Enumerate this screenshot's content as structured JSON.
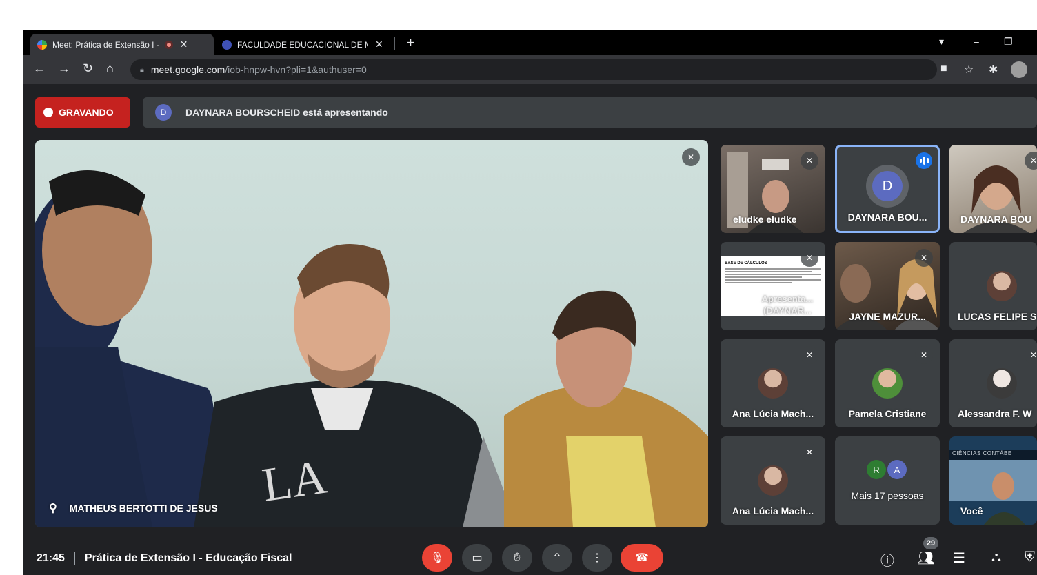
{
  "browser": {
    "tabs": [
      {
        "title": "Meet: Prática de Extensão I -",
        "active": true,
        "recording": true
      },
      {
        "title": "FACULDADE EDUCACIONAL DE M",
        "active": false
      }
    ],
    "url_domain": "meet.google.com",
    "url_path": "/iob-hnpw-hvn?pli=1&authuser=0"
  },
  "meet": {
    "recording_label": "GRAVANDO",
    "presenter_initial": "D",
    "presenting_text": "DAYNARA BOURSCHEID está apresentando",
    "main_speaker": "MATHEUS BERTOTTI DE JESUS",
    "tiles": [
      {
        "name": "eludke eludke"
      },
      {
        "name": "DAYNARA BOU...",
        "initial": "D"
      },
      {
        "name": "DAYNARA BOU"
      },
      {
        "name": "Apresenta... (DAYNAR...",
        "slide_title": "BASE DE CÁLCULOS"
      },
      {
        "name": "JAYNE MAZUR..."
      },
      {
        "name": "LUCAS FELIPE S"
      },
      {
        "name": "Ana Lúcia Mach..."
      },
      {
        "name": "Pamela Cristiane"
      },
      {
        "name": "Alessandra F. W"
      },
      {
        "name": "Ana Lúcia Mach..."
      },
      {
        "name": "Mais 17 pessoas",
        "initials": [
          "R",
          "A"
        ]
      },
      {
        "name": "Você",
        "banner": "CIÊNCIAS CONTÁBE"
      }
    ],
    "time": "21:45",
    "meeting_title": "Prática de Extensão I - Educação Fiscal",
    "participant_count": "29"
  },
  "colors": {
    "record_red": "#c5221f",
    "leave_red": "#ea4335",
    "speaking_blue": "#1a73e8"
  }
}
